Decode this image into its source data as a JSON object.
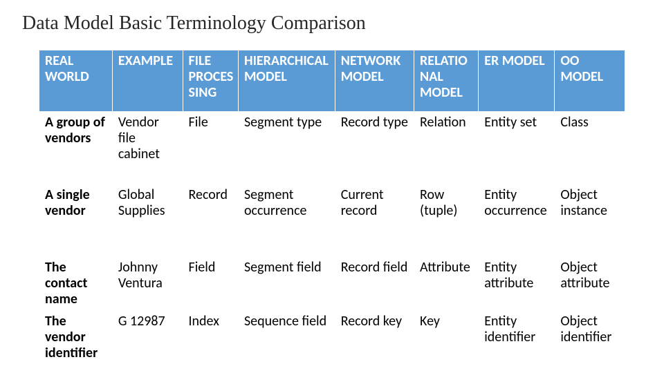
{
  "title": "Data Model Basic Terminology Comparison",
  "headers": [
    "REAL WORLD",
    "EXAMPLE",
    "FILE PROCESSING",
    "HIERARCHICAL MODEL",
    "NETWORK MODEL",
    "RELATIONAL MODEL",
    "ER MODEL",
    "OO MODEL"
  ],
  "rows": [
    {
      "rh": "A group of vendors",
      "c1": "Vendor file cabinet",
      "c2": "File",
      "c3": "Segment type",
      "c4": "Record type",
      "c5": "Relation",
      "c6": "Entity set",
      "c7": "Class"
    },
    {
      "rh": "A single vendor",
      "c1": "Global Supplies",
      "c2": "Record",
      "c3": "Segment occurrence",
      "c4": "Current record",
      "c5": "Row (tuple)",
      "c6": "Entity occurrence",
      "c7": "Object instance"
    },
    {
      "rh": "The contact name",
      "c1": "Johnny Ventura",
      "c2": "Field",
      "c3": "Segment field",
      "c4": "Record field",
      "c5": "Attribute",
      "c6": "Entity attribute",
      "c7": "Object attribute"
    },
    {
      "rh": "The vendor identifier",
      "c1": "G 12987",
      "c2": "Index",
      "c3": "Sequence field",
      "c4": "Record key",
      "c5": "Key",
      "c6": "Entity identifier",
      "c7": "Object identifier"
    }
  ],
  "chart_data": {
    "type": "table",
    "title": "Data Model Basic Terminology Comparison",
    "columns": [
      "REAL WORLD",
      "EXAMPLE",
      "FILE PROCESSING",
      "HIERARCHICAL MODEL",
      "NETWORK MODEL",
      "RELATIONAL MODEL",
      "ER MODEL",
      "OO MODEL"
    ],
    "rows": [
      [
        "A group of vendors",
        "Vendor file cabinet",
        "File",
        "Segment type",
        "Record type",
        "Relation",
        "Entity set",
        "Class"
      ],
      [
        "A single vendor",
        "Global Supplies",
        "Record",
        "Segment occurrence",
        "Current record",
        "Row (tuple)",
        "Entity occurrence",
        "Object instance"
      ],
      [
        "The contact name",
        "Johnny Ventura",
        "Field",
        "Segment field",
        "Record field",
        "Attribute",
        "Entity attribute",
        "Object attribute"
      ],
      [
        "The vendor identifier",
        "G 12987",
        "Index",
        "Sequence field",
        "Record key",
        "Key",
        "Entity identifier",
        "Object identifier"
      ]
    ]
  }
}
